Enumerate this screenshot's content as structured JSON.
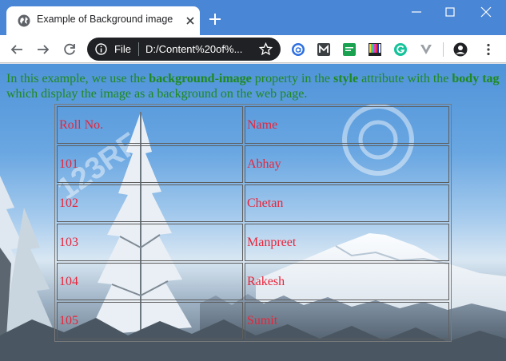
{
  "browser": {
    "tab": {
      "title": "Example of Background image"
    },
    "omnibox": {
      "scheme_label": "File",
      "url": "D:/Content%20of%..."
    }
  },
  "page": {
    "intro": {
      "text_1": "In this example, we use the ",
      "bold_1": "background-image",
      "text_2": " property in the ",
      "bold_2": "style",
      "text_3": " attribute with the ",
      "bold_3": "body tag",
      "text_4": " which display the image as a background on the web page."
    },
    "table": {
      "headers": [
        "Roll No.",
        "Name"
      ],
      "rows": [
        [
          "101",
          "Abhay"
        ],
        [
          "102",
          "Chetan"
        ],
        [
          "103",
          "Manpreet"
        ],
        [
          "104",
          "Rakesh"
        ],
        [
          "105",
          "Sumit"
        ]
      ]
    },
    "background_watermark": "123RF"
  },
  "colors": {
    "tabstrip": "#4a86d6",
    "intro_text": "#1e8a1e",
    "table_text": "#e8243a"
  }
}
